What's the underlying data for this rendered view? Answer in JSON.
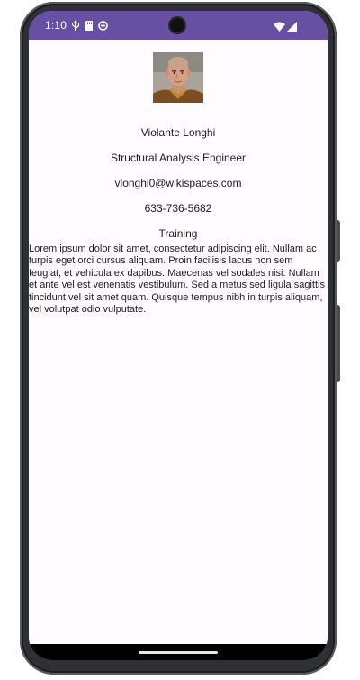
{
  "status_bar": {
    "time": "1:10",
    "bg_color": "#6750a4",
    "left_icons": [
      "usb-icon",
      "sd-card-icon",
      "data-saver-icon"
    ],
    "right_icons": [
      "wifi-icon",
      "cell-signal-icon"
    ]
  },
  "profile": {
    "avatar_icon": "avatar",
    "name": "Violante Longhi",
    "title": "Structural Analysis Engineer",
    "email": "vlonghi0@wikispaces.com",
    "phone": "633-736-5682",
    "department": "Training",
    "bio": "Lorem ipsum dolor sit amet, consectetur adipiscing elit. Nullam ac turpis eget orci cursus aliquam. Proin facilisis lacus non sem feugiat, et vehicula ex dapibus. Maecenas vel sodales nisi. Nullam et ante vel est venenatis vestibulum. Sed a metus sed ligula sagittis tincidunt vel sit amet quam. Quisque tempus nibh in turpis aliquam, vel volutpat odio vulputate."
  }
}
